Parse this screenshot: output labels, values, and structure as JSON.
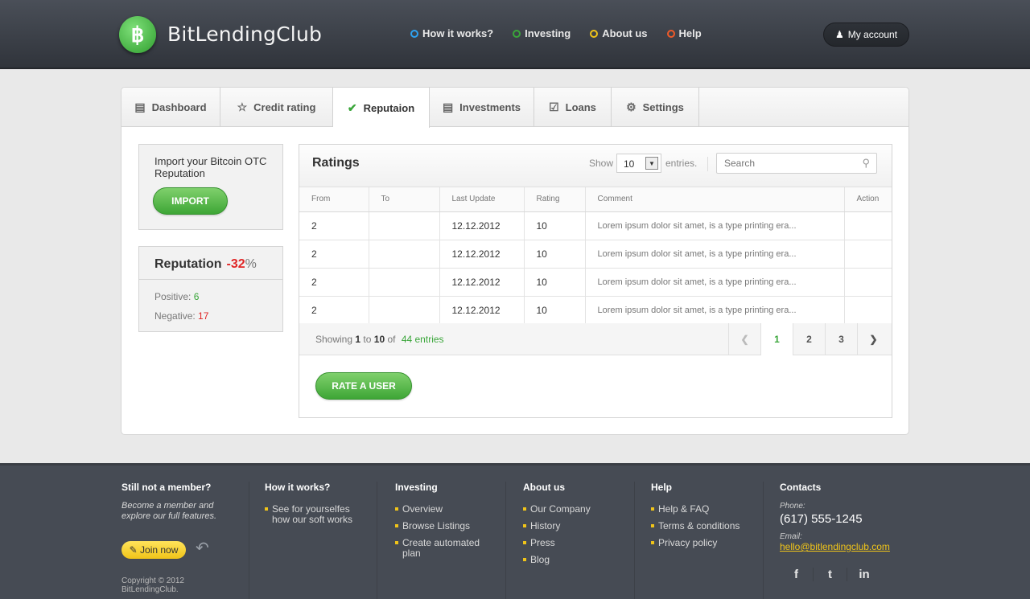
{
  "header": {
    "logo_mark": "฿",
    "brand": "BitLendingClub",
    "nav": [
      {
        "label": "How it works?",
        "color": "#2ea3f2"
      },
      {
        "label": "Investing",
        "color": "#3aa63a"
      },
      {
        "label": "About us",
        "color": "#f0c419"
      },
      {
        "label": "Help",
        "color": "#f05a28"
      }
    ],
    "account_label": "My account"
  },
  "tabs": [
    {
      "label": "Dashboard",
      "icon": "dashboard-icon"
    },
    {
      "label": "Credit rating",
      "icon": "star-icon"
    },
    {
      "label": "Reputaion",
      "icon": "checkmark-icon"
    },
    {
      "label": "Investments",
      "icon": "document-icon"
    },
    {
      "label": "Loans",
      "icon": "checklist-icon"
    },
    {
      "label": "Settings",
      "icon": "gear-icon"
    }
  ],
  "import": {
    "text": "Import your Bitcoin OTC Reputation",
    "button": "IMPORT"
  },
  "reputation": {
    "title": "Reputation",
    "value": "-32",
    "unit": "%",
    "positive_label": "Positive:",
    "positive_value": "6",
    "negative_label": "Negative:",
    "negative_value": "17"
  },
  "ratings": {
    "title": "Ratings",
    "show_label": "Show",
    "entries_value": "10",
    "entries_label": "entries.",
    "search_placeholder": "Search",
    "columns": [
      "From",
      "To",
      "Last Update",
      "Rating",
      "Comment",
      "Action"
    ],
    "rows": [
      {
        "from": "2",
        "to": "",
        "updated": "12.12.2012",
        "rating": "10",
        "comment": "Lorem ipsum dolor sit amet, is a type printing era...",
        "action": ""
      },
      {
        "from": "2",
        "to": "",
        "updated": "12.12.2012",
        "rating": "10",
        "comment": "Lorem ipsum dolor sit amet, is a type printing era...",
        "action": ""
      },
      {
        "from": "2",
        "to": "",
        "updated": "12.12.2012",
        "rating": "10",
        "comment": "Lorem ipsum dolor sit amet, is a type printing era...",
        "action": ""
      },
      {
        "from": "2",
        "to": "",
        "updated": "12.12.2012",
        "rating": "10",
        "comment": "Lorem ipsum dolor sit amet, is a type printing era...",
        "action": ""
      }
    ],
    "showing_prefix": "Showing",
    "showing_from": "1",
    "showing_to_word": "to",
    "showing_to": "10",
    "showing_of": "of",
    "showing_total": "44 entries",
    "pages": [
      "1",
      "2",
      "3"
    ],
    "rate_button": "RATE A USER"
  },
  "footer": {
    "member_title": "Still not a member?",
    "member_tagline": "Become a member and explore our full features.",
    "join_label": "Join now",
    "copyright": "Copyright © 2012 BitLendingClub.",
    "how_title": "How it works?",
    "how_items": [
      "See for yourselfes how our soft works"
    ],
    "investing_title": "Investing",
    "investing_items": [
      "Overview",
      "Browse Listings",
      "Create automated plan"
    ],
    "about_title": "About us",
    "about_items": [
      "Our Company",
      "History",
      "Press",
      "Blog"
    ],
    "help_title": "Help",
    "help_items": [
      "Help & FAQ",
      "Terms & conditions",
      "Privacy policy"
    ],
    "contacts_title": "Contacts",
    "phone_label": "Phone:",
    "phone": "(617) 555-1245",
    "email_label": "Email:",
    "email": "hello@bitlendingclub.com",
    "social": [
      {
        "glyph": "f",
        "icon": "facebook-icon"
      },
      {
        "glyph": "t",
        "icon": "twitter-icon"
      },
      {
        "glyph": "in",
        "icon": "linkedin-icon"
      }
    ]
  }
}
